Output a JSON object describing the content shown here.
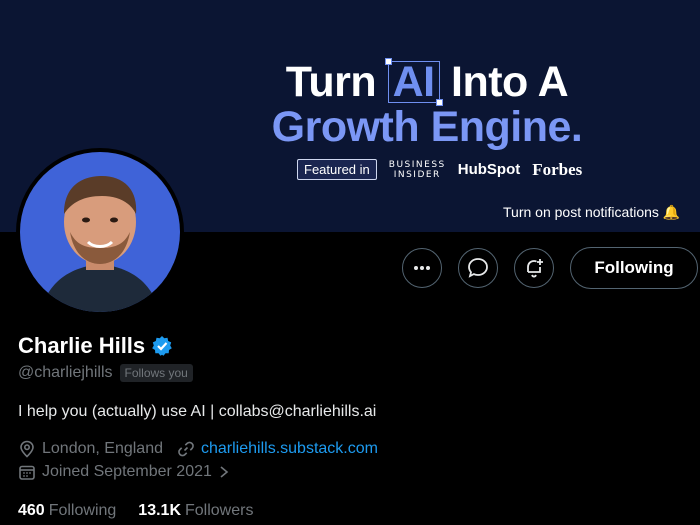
{
  "banner": {
    "line1_pre": "Turn ",
    "line1_ai": "AI",
    "line1_post": " Into A",
    "line2": "Growth Engine.",
    "featured_label": "Featured in",
    "logos": {
      "business_insider_top": "BUSINESS",
      "business_insider_bottom": "INSIDER",
      "hubspot": "HubSpot",
      "forbes": "Forbes"
    },
    "notification_text": "Turn on post notifications",
    "bell": "🔔"
  },
  "actions": {
    "more_icon": "more-dots-icon",
    "message_icon": "message-bubble-icon",
    "subscribe_icon": "bell-plus-icon",
    "following_label": "Following"
  },
  "profile": {
    "name": "Charlie Hills",
    "handle": "@charliejhills",
    "follows_you": "Follows you",
    "bio": "I help you (actually) use AI | collabs@charliehills.ai",
    "location": "London, England",
    "website": "charliehills.substack.com",
    "joined": "Joined September 2021",
    "following_count": "460",
    "following_label": "Following",
    "followers_count": "13.1K",
    "followers_label": "Followers"
  },
  "colors": {
    "banner_bg": "#0b1533",
    "accent_blue": "#7b97f5",
    "verified": "#1d9bf0",
    "link": "#1d9bf0",
    "avatar_bg": "#3f63d8"
  }
}
